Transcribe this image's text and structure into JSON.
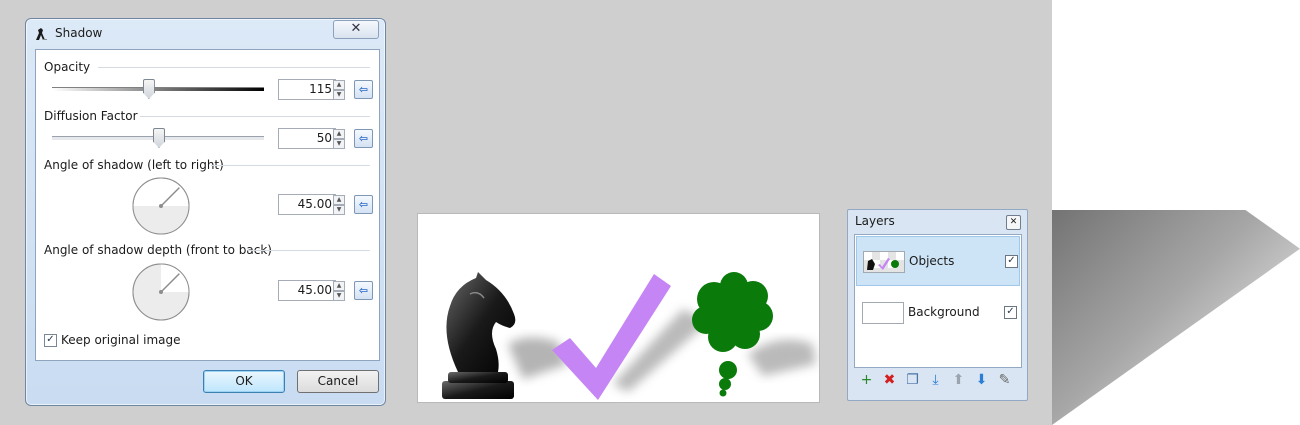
{
  "dialog": {
    "title": "Shadow",
    "close_glyph": "✕",
    "opacity": {
      "label": "Opacity",
      "value": "115",
      "slider_fraction": 0.45
    },
    "diffusion": {
      "label": "Diffusion Factor",
      "value": "50",
      "slider_fraction": 0.5
    },
    "angle_lr": {
      "label": "Angle of shadow (left to right)",
      "value": "45.00",
      "degrees": 45
    },
    "angle_depth": {
      "label": "Angle of shadow depth (front to back)",
      "value": "45.00",
      "degrees": 45
    },
    "keep_original": {
      "label": "Keep original image",
      "checked": true
    },
    "ok_label": "OK",
    "cancel_label": "Cancel",
    "icons": {
      "title": "shadow-effect-icon",
      "reset": "reset-arrow-icon",
      "spin_up": "▲",
      "spin_down": "▼",
      "reset_glyph": "⇦",
      "check_glyph": "✓"
    }
  },
  "canvas": {
    "colors": {
      "check": "#c585f5",
      "tree": "#0a7a0a",
      "knight": "#1a1a1a"
    }
  },
  "layers": {
    "title": "Layers",
    "close_glyph": "✕",
    "items": [
      {
        "name": "Objects",
        "visible": true,
        "selected": true
      },
      {
        "name": "Background",
        "visible": true,
        "selected": false
      }
    ],
    "toolbar": [
      {
        "icon": "add-layer-icon",
        "glyph": "+",
        "color": "#2a8a2a"
      },
      {
        "icon": "delete-layer-icon",
        "glyph": "✖",
        "color": "#d42020"
      },
      {
        "icon": "duplicate-layer-icon",
        "glyph": "❐",
        "color": "#4a72a8"
      },
      {
        "icon": "merge-down-icon",
        "glyph": "⤓",
        "color": "#2a7fd4"
      },
      {
        "icon": "move-up-icon",
        "glyph": "⬆",
        "color": "#9aa4b0"
      },
      {
        "icon": "move-down-icon",
        "glyph": "⬇",
        "color": "#2a7fd4"
      },
      {
        "icon": "layer-properties-icon",
        "glyph": "✎",
        "color": "#6a6a6a"
      }
    ]
  }
}
